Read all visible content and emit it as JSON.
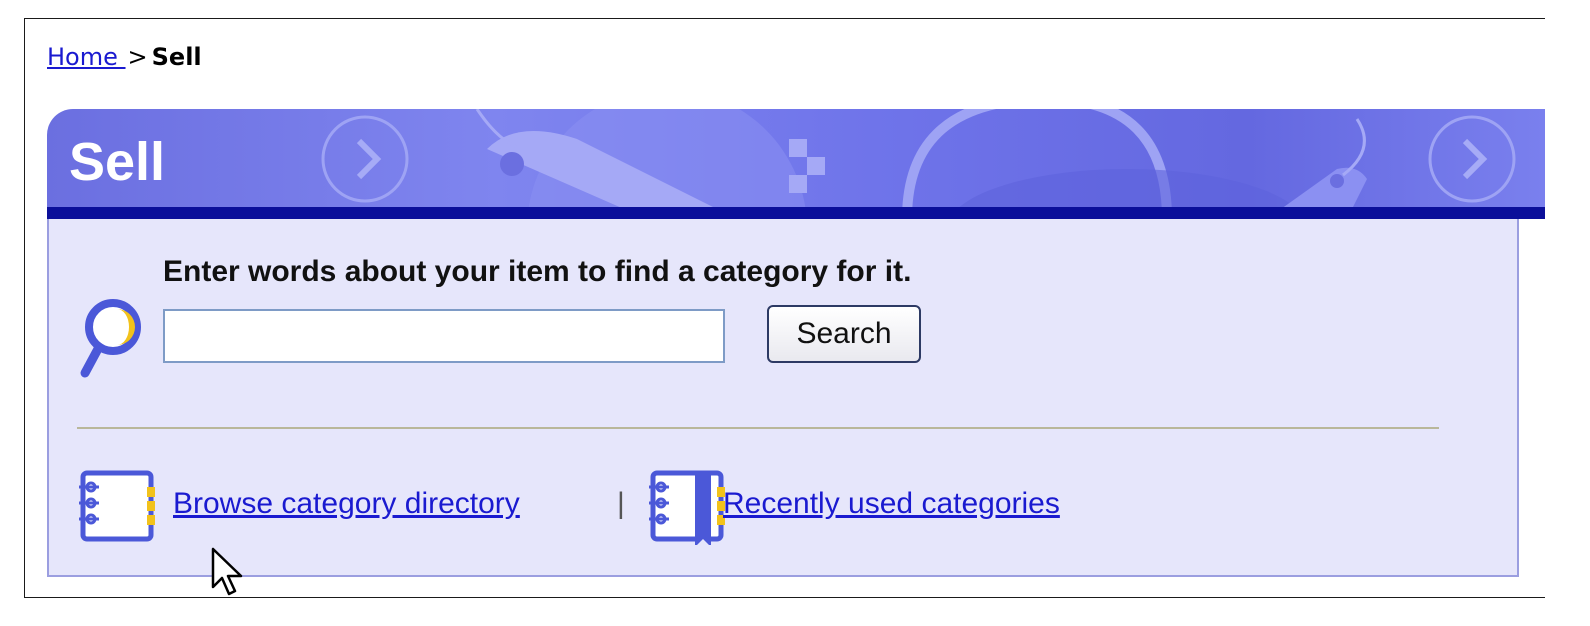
{
  "breadcrumb": {
    "home_label": "Home ",
    "separator": ">",
    "current_label": "Sell"
  },
  "banner": {
    "title": "Sell"
  },
  "search": {
    "prompt": "Enter words about your item to find a category for it.",
    "input_value": "",
    "input_placeholder": "",
    "button_label": "Search"
  },
  "links": {
    "browse_label": "Browse category directory",
    "separator": "|",
    "recent_label": "Recently used categories"
  },
  "icons": {
    "search": "magnifier-icon",
    "browse": "notebook-icon",
    "recent": "bookmarked-notebook-icon",
    "cursor": "mouse-pointer-icon"
  },
  "colors": {
    "banner": "#6b6fe0",
    "banner_bar": "#0b0f9a",
    "panel_bg": "#e6e6fb",
    "link": "#1a1ad0"
  }
}
